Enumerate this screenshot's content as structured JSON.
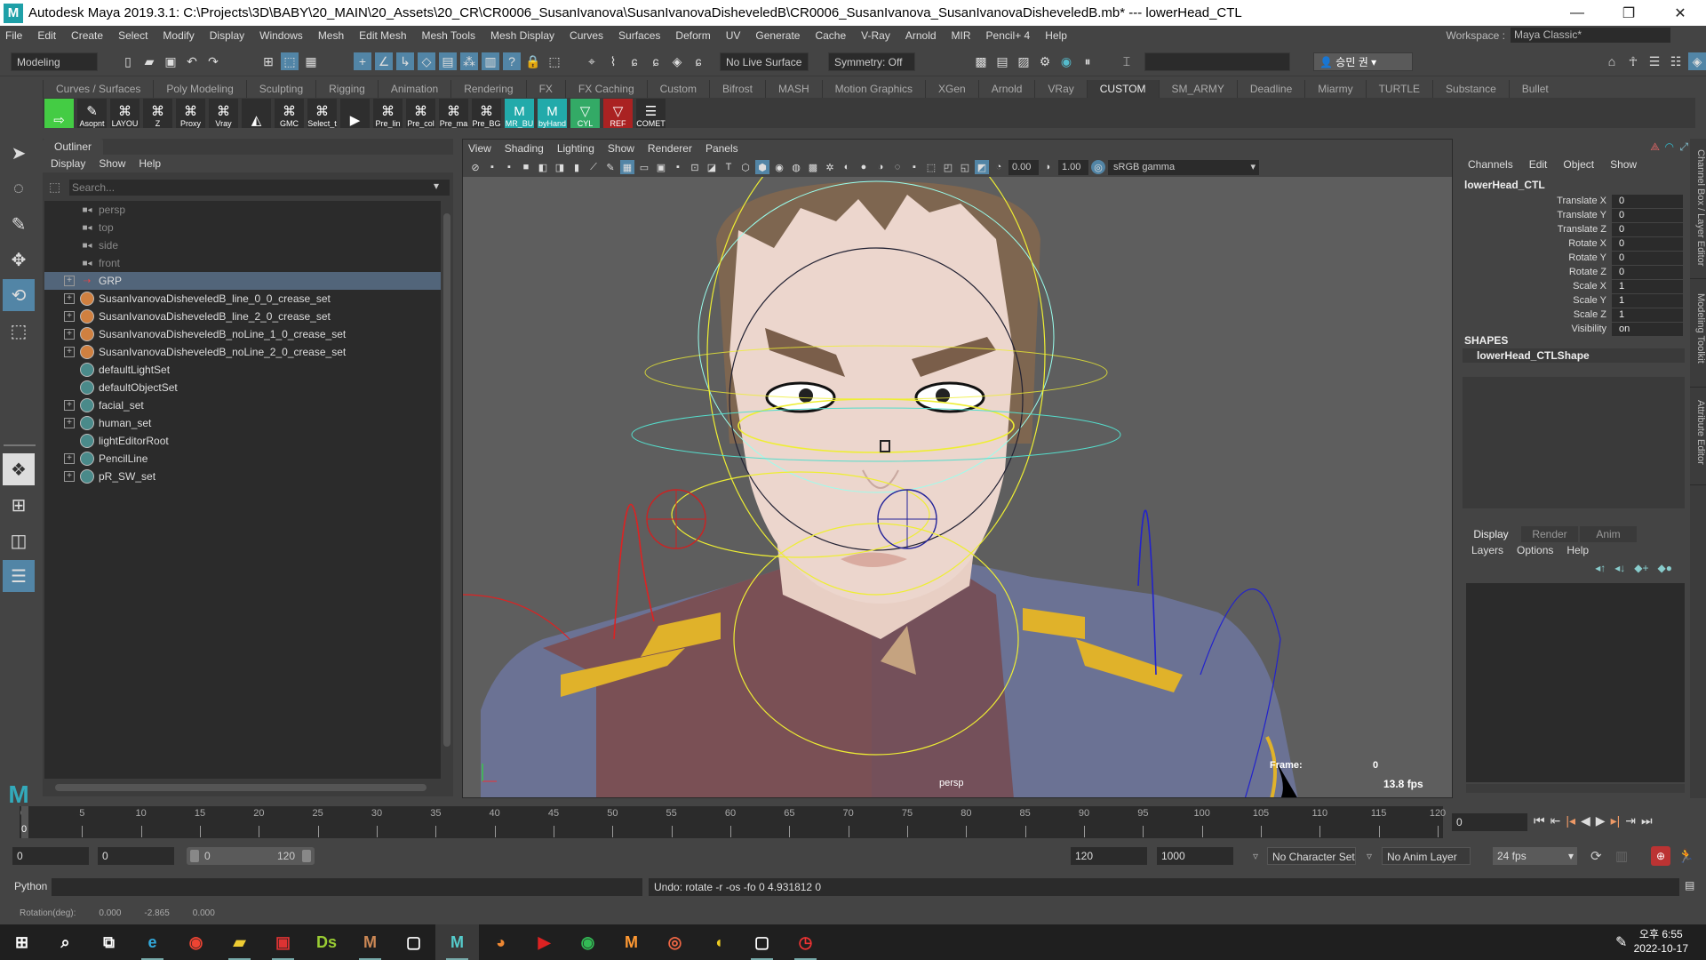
{
  "window": {
    "title": "Autodesk Maya 2019.3.1: C:\\Projects\\3D\\BABY\\20_MAIN\\20_Assets\\20_CR\\CR0006_SusanIvanova\\SusanIvanovaDisheveledB\\CR0006_SusanIvanova_SusanIvanovaDisheveledB.mb*   ---   lowerHead_CTL",
    "minimize": "—",
    "restore": "❐",
    "close": "✕"
  },
  "menubar": {
    "items": [
      "File",
      "Edit",
      "Create",
      "Select",
      "Modify",
      "Display",
      "Windows",
      "Mesh",
      "Edit Mesh",
      "Mesh Tools",
      "Mesh Display",
      "Curves",
      "Surfaces",
      "Deform",
      "UV",
      "Generate",
      "Cache",
      "V-Ray",
      "Arnold",
      "MIR",
      "Pencil+ 4",
      "Help"
    ],
    "workspace_label": "Workspace :",
    "workspace_value": "Maya Classic*"
  },
  "statusline": {
    "menuset": "Modeling",
    "live_surface": "No Live Surface",
    "symmetry": "Symmetry: Off",
    "user": "승민 권"
  },
  "shelf": {
    "tabs": [
      "Curves / Surfaces",
      "Poly Modeling",
      "Sculpting",
      "Rigging",
      "Animation",
      "Rendering",
      "FX",
      "FX Caching",
      "Custom",
      "Bifrost",
      "MASH",
      "Motion Graphics",
      "XGen",
      "Arnold",
      "VRay",
      "CUSTOM",
      "SM_ARMY",
      "Deadline",
      "Miarmy",
      "TURTLE",
      "Substance",
      "Bullet"
    ],
    "active_tab": "CUSTOM",
    "buttons": [
      "",
      "Asopnt",
      "LAYOU",
      "Z",
      "Proxy",
      "Vray",
      "",
      "GMC",
      "Select_t",
      "",
      "Pre_lin",
      "Pre_col",
      "Pre_ma",
      "Pre_BG",
      "MR_BU",
      "byHand",
      "CYL",
      "REF",
      "COMET"
    ]
  },
  "outliner": {
    "title": "Outliner",
    "menu": [
      "Display",
      "Show",
      "Help"
    ],
    "search_placeholder": "Search...",
    "items": [
      {
        "label": "persp",
        "type": "camera",
        "expand": false
      },
      {
        "label": "top",
        "type": "camera",
        "expand": false
      },
      {
        "label": "side",
        "type": "camera",
        "expand": false
      },
      {
        "label": "front",
        "type": "camera",
        "expand": false
      },
      {
        "label": "GRP",
        "type": "grp",
        "expand": true,
        "selected": true
      },
      {
        "label": "SusanIvanovaDisheveledB_line_0_0_crease_set",
        "type": "crease",
        "expand": true
      },
      {
        "label": "SusanIvanovaDisheveledB_line_2_0_crease_set",
        "type": "crease",
        "expand": true
      },
      {
        "label": "SusanIvanovaDisheveledB_noLine_1_0_crease_set",
        "type": "crease",
        "expand": true
      },
      {
        "label": "SusanIvanovaDisheveledB_noLine_2_0_crease_set",
        "type": "crease",
        "expand": true
      },
      {
        "label": "defaultLightSet",
        "type": "set",
        "expand": false
      },
      {
        "label": "defaultObjectSet",
        "type": "set",
        "expand": false
      },
      {
        "label": "facial_set",
        "type": "set",
        "expand": true
      },
      {
        "label": "human_set",
        "type": "set",
        "expand": true
      },
      {
        "label": "lightEditorRoot",
        "type": "set",
        "expand": false
      },
      {
        "label": "PencilLine",
        "type": "set",
        "expand": true
      },
      {
        "label": "pR_SW_set",
        "type": "set",
        "expand": true
      }
    ]
  },
  "viewport": {
    "menu": [
      "View",
      "Shading",
      "Lighting",
      "Show",
      "Renderer",
      "Panels"
    ],
    "exposure": "0.00",
    "gamma": "1.00",
    "color_space": "sRGB gamma",
    "camera_label": "persp",
    "frame_label": "Frame:",
    "frame_value": "0",
    "fps": "13.8 fps"
  },
  "channelbox": {
    "menu": [
      "Channels",
      "Edit",
      "Object",
      "Show"
    ],
    "object": "lowerHead_CTL",
    "attributes": [
      {
        "label": "Translate X",
        "value": "0"
      },
      {
        "label": "Translate Y",
        "value": "0"
      },
      {
        "label": "Translate Z",
        "value": "0"
      },
      {
        "label": "Rotate X",
        "value": "0"
      },
      {
        "label": "Rotate Y",
        "value": "0"
      },
      {
        "label": "Rotate Z",
        "value": "0"
      },
      {
        "label": "Scale X",
        "value": "1"
      },
      {
        "label": "Scale Y",
        "value": "1"
      },
      {
        "label": "Scale Z",
        "value": "1"
      },
      {
        "label": "Visibility",
        "value": "on"
      }
    ],
    "shapes_header": "SHAPES",
    "shape": "lowerHead_CTLShape"
  },
  "side_tabs": [
    "Channel Box / Layer Editor",
    "Modeling Toolkit",
    "Attribute Editor"
  ],
  "layer_editor": {
    "tabs": [
      "Display",
      "Render",
      "Anim"
    ],
    "active_tab": "Display",
    "menu": [
      "Layers",
      "Options",
      "Help"
    ]
  },
  "timeslider": {
    "start": 0,
    "end": 120,
    "step": 5,
    "current_frame": "0"
  },
  "range": {
    "start": "0",
    "anim_start": "0",
    "slider_start": "0",
    "slider_end": "120",
    "end": "120",
    "anim_end": "1000",
    "character_set": "No Character Set",
    "anim_layer": "No Anim Layer",
    "fps": "24 fps"
  },
  "cmdline": {
    "lang": "Python",
    "result": "Undo: rotate -r -os -fo 0 4.931812 0"
  },
  "helpline": {
    "label": "Rotation(deg):",
    "x": "0.000",
    "y": "-2.865",
    "z": "0.000"
  },
  "taskbar": {
    "time": "오후 6:55",
    "date": "2022-10-17"
  }
}
